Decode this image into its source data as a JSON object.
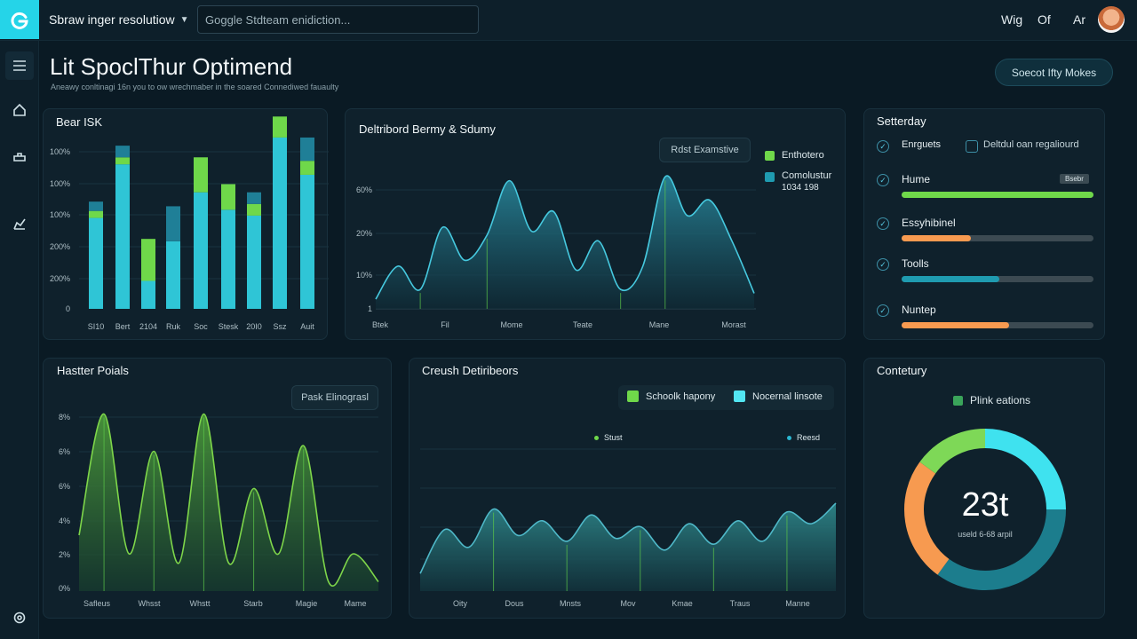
{
  "topbar": {
    "workspace_label": "Sbraw inger resolutiow",
    "search_placeholder": "Goggle Stdteam enidiction...",
    "right_items": [
      "Wig",
      "Of",
      "Ar"
    ]
  },
  "header": {
    "title": "Lit SpoclThur Optimend",
    "subtitle": "Aneawy conltinagi 16n you to ow wrechmaber in the soared Connediwed fauaulty",
    "action_label": "Soecot Ifty Mokes"
  },
  "colors": {
    "background": "#0a1a24",
    "card": "#0f212c",
    "accent_cyan": "#2ad6e8",
    "accent_teal": "#1f9bb0",
    "accent_green": "#6fd84a",
    "accent_orange": "#f79a50"
  },
  "bar_card": {
    "title": "Bear ISK",
    "chart_data": {
      "type": "bar",
      "categories": [
        "SI10",
        "Bert",
        "2104",
        "Ruk",
        "Soc",
        "Stesk",
        "20I0",
        "Ssz",
        "Auit"
      ],
      "y_tick_labels": [
        "100%",
        "100%",
        "100%",
        "200%",
        "200%",
        "0"
      ],
      "series": [
        {
          "color": "#2fc5d6",
          "values": [
            78,
            124,
            24,
            58,
            100,
            85,
            80,
            147,
            115
          ]
        },
        {
          "color": "#6fd84a",
          "values": [
            6,
            6,
            36,
            0,
            30,
            22,
            10,
            18,
            12
          ]
        },
        {
          "color": "#1f7f97",
          "values": [
            8,
            10,
            0,
            30,
            0,
            0,
            10,
            0,
            20
          ]
        }
      ]
    }
  },
  "area_card": {
    "title": "Deltribord Bermy & Sdumy",
    "button_label": "Rdst Examstive",
    "legend": [
      {
        "label": "Enthotero",
        "color": "#6fd84a"
      },
      {
        "label": "Comolustur",
        "sub": "1034 198",
        "color": "#1f9bb0"
      }
    ],
    "chart_data": {
      "type": "area",
      "x_tick_labels": [
        "Btek",
        "Fil",
        "Mome",
        "Teate",
        "Mane",
        "Morast"
      ],
      "y_tick_labels": [
        "60%",
        "20%",
        "10%",
        "1"
      ],
      "y_range": [
        0,
        100
      ],
      "values": [
        5,
        22,
        10,
        42,
        25,
        38,
        66,
        40,
        50,
        20,
        35,
        10,
        22,
        68,
        48,
        56,
        35,
        8
      ]
    }
  },
  "tasks_card": {
    "title": "Setterday",
    "header_checked": "Enrguets",
    "header_option": "Deltdul oan regaliourd",
    "tasks": [
      {
        "label": "Hume",
        "percent": 100,
        "color": "#6fd84a",
        "badge": "Bsebr"
      },
      {
        "label": "Essyhibinel",
        "percent": 36,
        "color": "#f79a50"
      },
      {
        "label": "Toolls",
        "percent": 51,
        "color": "#1f9bb0"
      },
      {
        "label": "Nuntep",
        "percent": 56,
        "color": "#f79a50"
      }
    ]
  },
  "green_card": {
    "title": "Hastter Poials",
    "button_label": "Pask Elinograsl",
    "chart_data": {
      "type": "area",
      "x_tick_labels": [
        "Safleus",
        "Whsst",
        "Whstt",
        "Starb",
        "Magie",
        "Mame"
      ],
      "y_tick_labels": [
        "8%",
        "6%",
        "6%",
        "4%",
        "2%",
        "0%"
      ],
      "y_range": [
        0,
        100
      ],
      "values": [
        30,
        95,
        20,
        75,
        15,
        95,
        15,
        55,
        20,
        78,
        5,
        20,
        5
      ]
    }
  },
  "bottom_chart_card": {
    "title": "Creush Detiribeors",
    "legend": [
      {
        "label": "Schoolk hapony",
        "color": "#6fd84a"
      },
      {
        "label": "Nocernal linsote",
        "color": "#52e6f2"
      }
    ],
    "sub_legend": [
      {
        "label": "Stust",
        "color": "#6fd84a"
      },
      {
        "label": "Reesd",
        "color": "#2ab7d1"
      }
    ],
    "chart_data": {
      "type": "area",
      "x_tick_labels": [
        "Oity",
        "Dous",
        "Mnsts",
        "Mov",
        "Kmae",
        "Traus",
        "Manne"
      ],
      "y_range": [
        0,
        100
      ],
      "values": [
        12,
        42,
        30,
        56,
        38,
        48,
        34,
        52,
        36,
        44,
        28,
        46,
        32,
        48,
        34,
        54,
        46,
        60
      ]
    }
  },
  "donut_card": {
    "title": "Contetury",
    "legend_label": "Plink eations",
    "center_value": "23t",
    "center_sub": "useld 6-68 arpil",
    "chart_data": {
      "type": "pie",
      "slices": [
        {
          "value": 25,
          "color": "#3fe2ef"
        },
        {
          "value": 35,
          "color": "#1c7d8d"
        },
        {
          "value": 25,
          "color": "#f79a50"
        },
        {
          "value": 15,
          "color": "#7ed857"
        }
      ]
    }
  }
}
